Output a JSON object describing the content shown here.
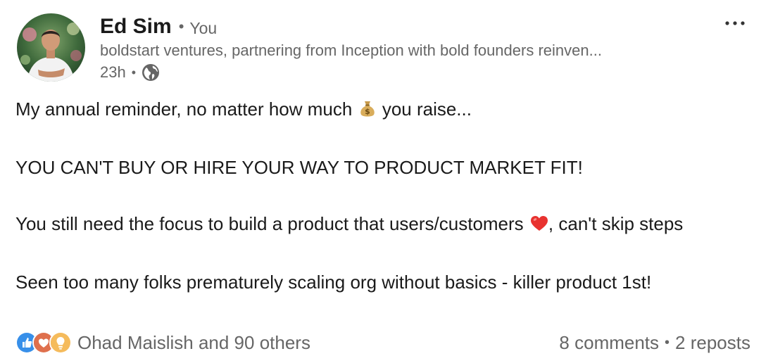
{
  "author": {
    "name": "Ed Sim",
    "relation": "You",
    "headline": "boldstart ventures, partnering from Inception with bold founders reinven...",
    "time": "23h",
    "visibility_icon": "globe-icon"
  },
  "menu": {
    "more_icon": "ellipsis-icon"
  },
  "post": {
    "line1_before": "My annual reminder, no matter how much",
    "line1_emoji": "money-bag-emoji",
    "line1_after": "you raise...",
    "line2": "YOU CAN'T BUY OR HIRE YOUR WAY TO PRODUCT MARKET FIT!",
    "line3_before": "You still need the focus to build a product that users/customers",
    "line3_emoji": "red-heart-emoji",
    "line3_after": ", can't skip steps",
    "line4": "Seen too many folks prematurely scaling org without basics - killer product 1st!"
  },
  "social": {
    "reaction_icons": [
      "like-icon",
      "love-icon",
      "insightful-icon"
    ],
    "reactors": "Ohad Maislish and 90 others",
    "comments": "8 comments",
    "reposts": "2 reposts"
  },
  "colors": {
    "text": "#1a1a1a",
    "muted": "#666666",
    "like_blue": "#378fe9",
    "love_red": "#df704d",
    "insight_yellow": "#f5bb5c"
  }
}
